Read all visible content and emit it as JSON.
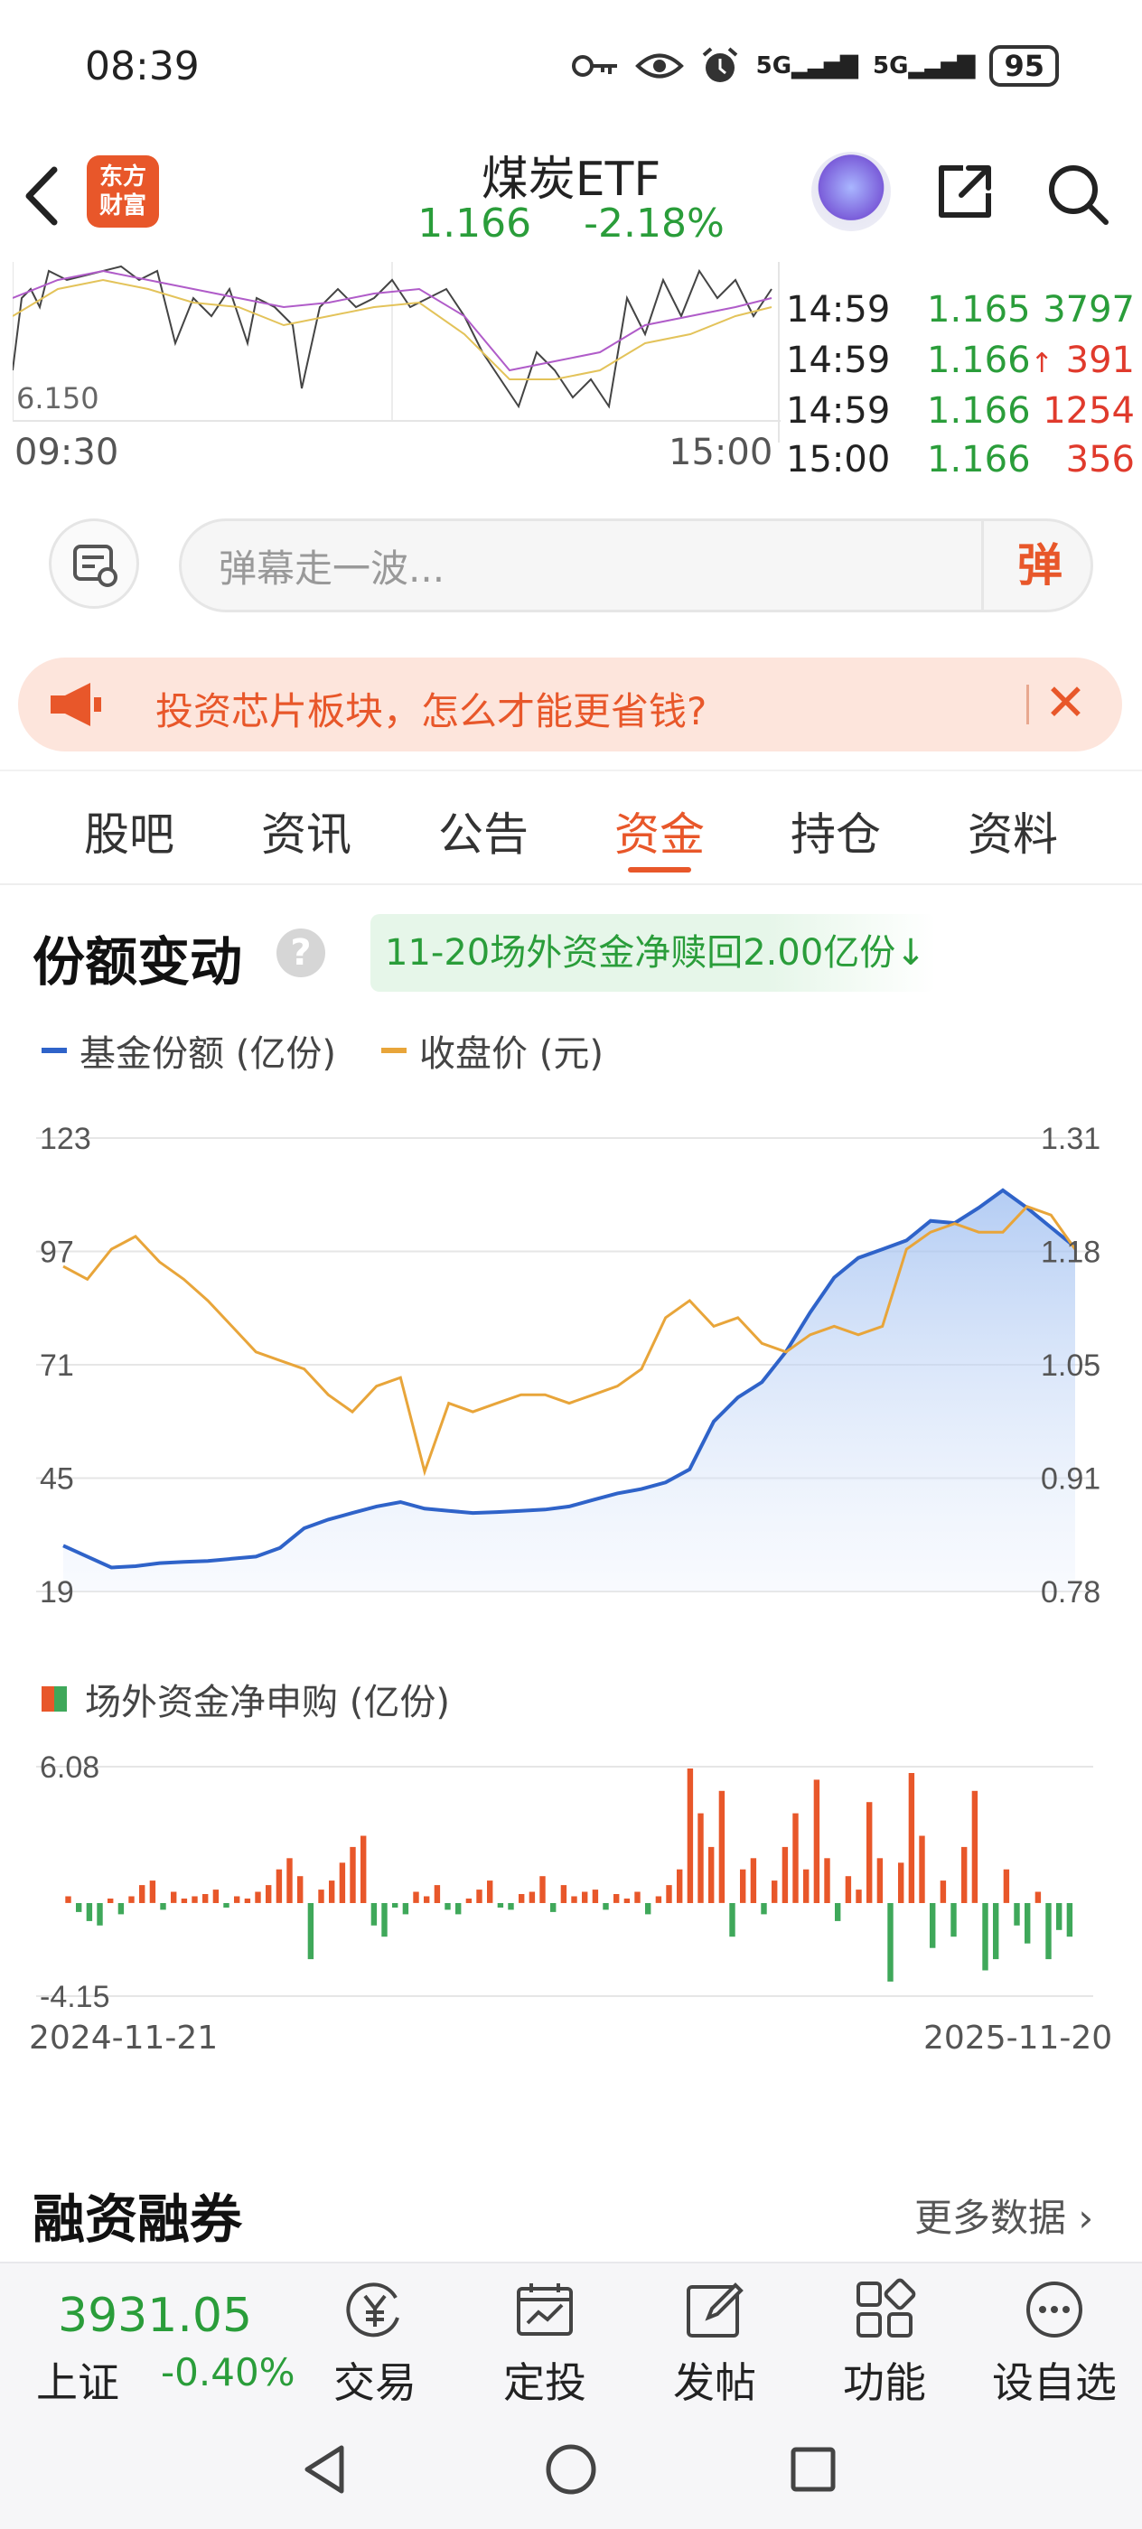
{
  "status_bar": {
    "time": "08:39",
    "network1": "5G",
    "network2": "5G",
    "battery": "95"
  },
  "header": {
    "logo_text": "东方\n财富",
    "title": "煤炭ETF",
    "price": "1.166",
    "change": "-2.18%"
  },
  "intraday": {
    "low_label": "6.150",
    "time_start": "09:30",
    "time_end": "15:00",
    "trades": [
      {
        "time": "14:59",
        "price": "1.165",
        "volume": "3797",
        "dir": "down",
        "arrow": ""
      },
      {
        "time": "14:59",
        "price": "1.166",
        "volume": "391",
        "dir": "up",
        "arrow": "↑"
      },
      {
        "time": "14:59",
        "price": "1.166",
        "volume": "1254",
        "dir": "up",
        "arrow": ""
      },
      {
        "time": "15:00",
        "price": "1.166",
        "volume": "356",
        "dir": "up",
        "arrow": ""
      }
    ]
  },
  "danmu": {
    "placeholder": "弹幕走一波...",
    "send_label": "弹"
  },
  "banner": {
    "text": "投资芯片板块，怎么才能更省钱?",
    "close": "✕"
  },
  "tabs": [
    {
      "label": "股吧"
    },
    {
      "label": "资讯"
    },
    {
      "label": "公告"
    },
    {
      "label": "资金",
      "active": true
    },
    {
      "label": "持仓"
    },
    {
      "label": "资料"
    }
  ],
  "section_share": {
    "title": "份额变动",
    "help": "?",
    "badge": "11-20场外资金净赎回2.00亿份↓",
    "legend_share": "基金份额 (亿份)",
    "legend_close": "收盘价 (元)",
    "legend_flow": "场外资金净申购 (亿份)",
    "date_start": "2024-11-21",
    "date_end": "2025-11-20"
  },
  "chart_data": [
    {
      "type": "line",
      "series": [
        {
          "name": "基金份额 (亿份)",
          "color": "#2f63c9",
          "axis": "left",
          "values": [
            29.5,
            27,
            24.5,
            24.8,
            25.5,
            25.8,
            26,
            26.5,
            27,
            29,
            33.5,
            35.5,
            37,
            38.5,
            39.5,
            38,
            37.5,
            37,
            37.2,
            37.5,
            37.8,
            38.5,
            40,
            41.5,
            42.5,
            44,
            47,
            58,
            63.5,
            67,
            74,
            83,
            91,
            95.5,
            97.5,
            99.5,
            104,
            103.5,
            107,
            111,
            107,
            102.5,
            98
          ]
        },
        {
          "name": "收盘价 (元)",
          "color": "#e8a53a",
          "axis": "right",
          "values": [
            1.16,
            1.145,
            1.18,
            1.195,
            1.165,
            1.145,
            1.12,
            1.09,
            1.06,
            1.05,
            1.04,
            1.01,
            0.99,
            1.02,
            1.03,
            0.92,
            1.0,
            0.99,
            1.0,
            1.01,
            1.01,
            1.0,
            1.01,
            1.02,
            1.04,
            1.1,
            1.12,
            1.09,
            1.1,
            1.07,
            1.06,
            1.08,
            1.09,
            1.08,
            1.09,
            1.18,
            1.2,
            1.21,
            1.2,
            1.2,
            1.23,
            1.22,
            1.18
          ]
        }
      ],
      "left_ticks": [
        "123",
        "97",
        "71",
        "45",
        "19"
      ],
      "right_ticks": [
        "1.31",
        "1.18",
        "1.05",
        "0.91",
        "0.78"
      ],
      "ylim_left": [
        19,
        123
      ],
      "ylim_right": [
        0.78,
        1.31
      ],
      "grid": true
    },
    {
      "type": "bar",
      "series": [
        {
          "name": "场外资金净申购 (亿份)",
          "values": [
            0.3,
            -0.4,
            -0.8,
            -1.0,
            0.2,
            -0.5,
            0.3,
            0.8,
            1.0,
            -0.3,
            0.5,
            0.2,
            0.3,
            0.4,
            0.6,
            -0.2,
            0.3,
            0.2,
            0.5,
            0.8,
            1.5,
            2.0,
            1.2,
            -2.5,
            0.6,
            1.0,
            1.8,
            2.5,
            3.0,
            -1.0,
            -1.5,
            -0.2,
            -0.5,
            0.5,
            0.3,
            0.8,
            -0.3,
            -0.5,
            0.2,
            0.6,
            1.0,
            -0.2,
            -0.3,
            0.4,
            0.5,
            1.2,
            -0.4,
            0.8,
            0.3,
            0.5,
            0.6,
            -0.3,
            0.4,
            0.2,
            0.5,
            -0.5,
            0.3,
            0.8,
            1.5,
            6.0,
            4.0,
            2.5,
            5.0,
            -1.5,
            1.5,
            2.0,
            -0.5,
            1.0,
            2.5,
            4.0,
            1.5,
            5.5,
            2.0,
            -0.8,
            1.2,
            0.6,
            4.5,
            2.0,
            -3.5,
            1.8,
            5.8,
            3.0,
            -2.0,
            1.0,
            -1.5,
            2.5,
            5.0,
            -3.0,
            -2.5,
            1.5,
            -1.0,
            -1.8,
            0.5,
            -2.5,
            -1.2,
            -1.5
          ]
        }
      ],
      "ticks": [
        "6.08",
        "-4.15"
      ],
      "ylim": [
        -4.15,
        6.08
      ],
      "colors": {
        "positive": "#e8572a",
        "negative": "#3fa85a"
      },
      "x_range": [
        "2024-11-21",
        "2025-11-20"
      ]
    }
  ],
  "section_margin": {
    "title": "融资融券",
    "more": "更多数据"
  },
  "bottom_bar": {
    "index_value": "3931.05",
    "index_name": "上证",
    "index_change": "-0.40%",
    "nav": [
      {
        "label": "交易"
      },
      {
        "label": "定投"
      },
      {
        "label": "发帖"
      },
      {
        "label": "功能"
      },
      {
        "label": "设自选"
      }
    ]
  },
  "colors": {
    "accent": "#e8572a",
    "down": "#2a9d3a",
    "up": "#e03a2c"
  }
}
